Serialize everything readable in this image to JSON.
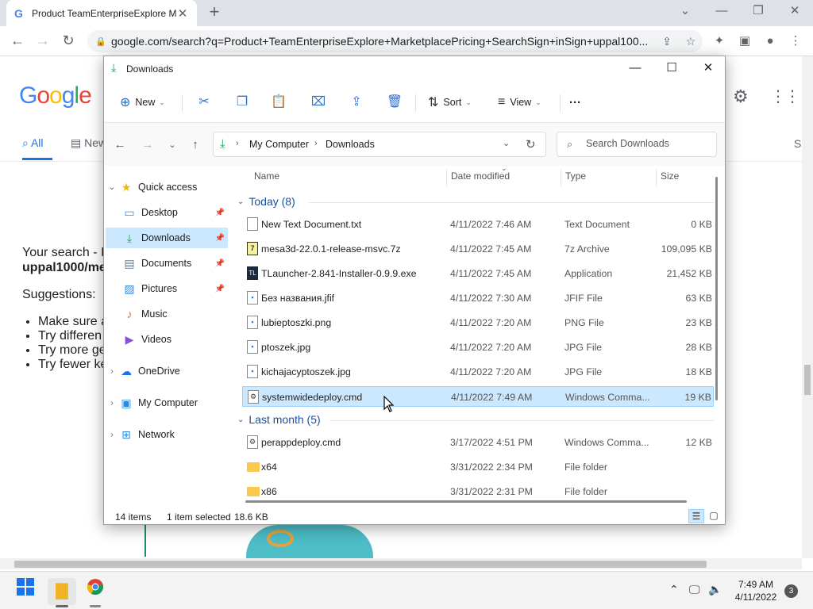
{
  "browser": {
    "tab_title": "Product TeamEnterpriseExplore M",
    "url": "google.com/search?q=Product+TeamEnterpriseExplore+MarketplacePricing+SearchSign+inSign+uppal100..."
  },
  "google": {
    "logo": [
      "G",
      "o",
      "o",
      "g",
      "l",
      "e"
    ],
    "tabs": {
      "all": "All",
      "news": "New"
    },
    "right_tab": "S",
    "search_text_1": "Your search - I",
    "search_text_2": "uppal1000/me",
    "suggestions_label": "Suggestions:",
    "suggestions": [
      "Make sure a",
      "Try differen",
      "Try more ge",
      "Try fewer ke"
    ]
  },
  "explorer": {
    "title": "Downloads",
    "commands": {
      "new": "New",
      "sort": "Sort",
      "view": "View",
      "more": "···"
    },
    "breadcrumb": [
      "My Computer",
      "Downloads"
    ],
    "search_placeholder": "Search Downloads",
    "nav": {
      "quick_access": "Quick access",
      "desktop": "Desktop",
      "downloads": "Downloads",
      "documents": "Documents",
      "pictures": "Pictures",
      "music": "Music",
      "videos": "Videos",
      "onedrive": "OneDrive",
      "my_computer": "My Computer",
      "network": "Network"
    },
    "columns": {
      "name": "Name",
      "date": "Date modified",
      "type": "Type",
      "size": "Size"
    },
    "groups": {
      "today": "Today (8)",
      "last_month": "Last month (5)"
    },
    "files_today": [
      {
        "name": "New Text Document.txt",
        "date": "4/11/2022 7:46 AM",
        "type": "Text Document",
        "size": "0 KB",
        "icon": "txt"
      },
      {
        "name": "mesa3d-22.0.1-release-msvc.7z",
        "date": "4/11/2022 7:45 AM",
        "type": "7z Archive",
        "size": "109,095 KB",
        "icon": "zip"
      },
      {
        "name": "TLauncher-2.841-Installer-0.9.9.exe",
        "date": "4/11/2022 7:45 AM",
        "type": "Application",
        "size": "21,452 KB",
        "icon": "exe"
      },
      {
        "name": "Без названия.jfif",
        "date": "4/11/2022 7:30 AM",
        "type": "JFIF File",
        "size": "63 KB",
        "icon": "img"
      },
      {
        "name": "lubieptoszki.png",
        "date": "4/11/2022 7:20 AM",
        "type": "PNG File",
        "size": "23 KB",
        "icon": "img"
      },
      {
        "name": "ptoszek.jpg",
        "date": "4/11/2022 7:20 AM",
        "type": "JPG File",
        "size": "28 KB",
        "icon": "img"
      },
      {
        "name": "kichajacyptoszek.jpg",
        "date": "4/11/2022 7:20 AM",
        "type": "JPG File",
        "size": "18 KB",
        "icon": "img"
      },
      {
        "name": "systemwidedeploy.cmd",
        "date": "4/11/2022 7:49 AM",
        "type": "Windows Comma...",
        "size": "19 KB",
        "icon": "cmd"
      }
    ],
    "files_last_month": [
      {
        "name": "perappdeploy.cmd",
        "date": "3/17/2022 4:51 PM",
        "type": "Windows Comma...",
        "size": "12 KB",
        "icon": "cmd"
      },
      {
        "name": "x64",
        "date": "3/31/2022 2:34 PM",
        "type": "File folder",
        "size": "",
        "icon": "folder"
      },
      {
        "name": "x86",
        "date": "3/31/2022 2:31 PM",
        "type": "File folder",
        "size": "",
        "icon": "folder"
      }
    ],
    "status": {
      "items": "14 items",
      "selected": "1 item selected",
      "size": "18.6 KB"
    }
  },
  "taskbar": {
    "time": "7:49 AM",
    "date": "4/11/2022",
    "notifications": "3"
  }
}
